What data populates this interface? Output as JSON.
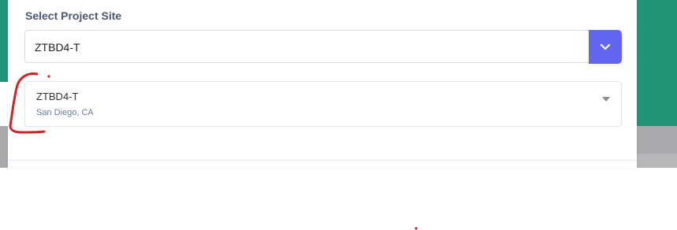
{
  "dialog": {
    "label": "Select Project Site",
    "selected_value": "ZTBD4-T"
  },
  "options": [
    {
      "title": "ZTBD4-T",
      "subtitle": "San Diego, CA"
    }
  ],
  "colors": {
    "accent": "#6366f1",
    "background_teal": "#1f9476",
    "annotation_red": "#d02424"
  },
  "icons": {
    "dropdown_button": "chevron-down-icon",
    "option_expand": "caret-down-icon"
  }
}
